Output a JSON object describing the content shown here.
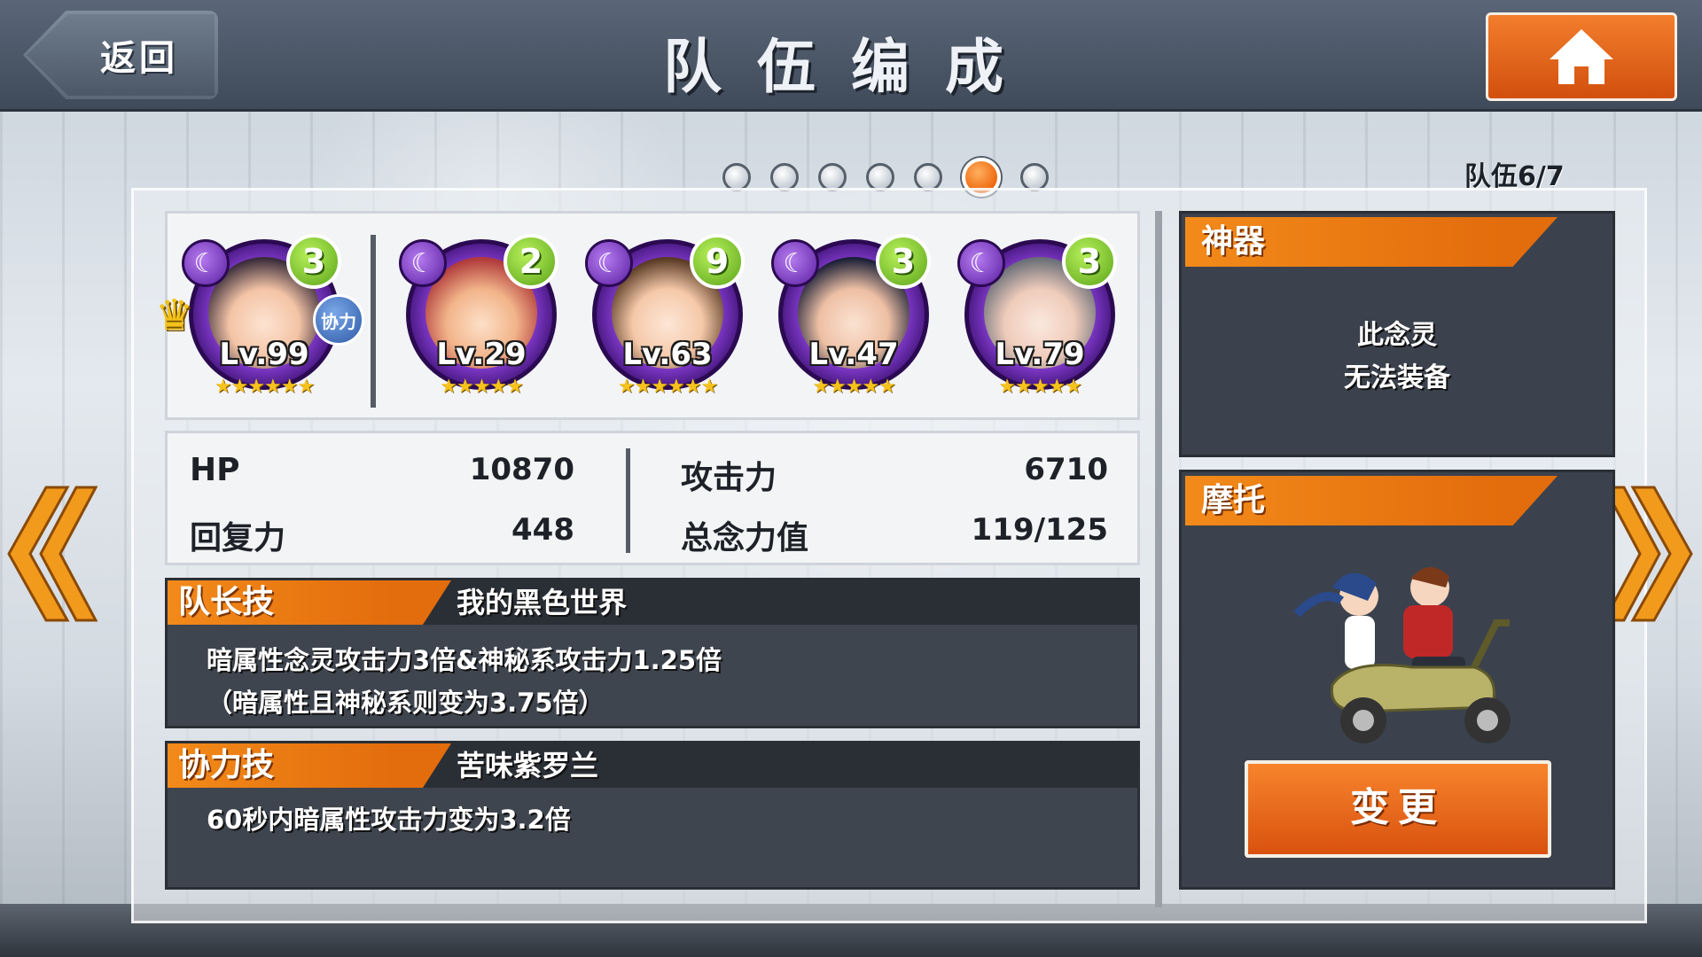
{
  "header": {
    "back_label": "返回",
    "title": "队伍编成",
    "home_icon": "home-icon"
  },
  "pager": {
    "total": 7,
    "active_index": 5,
    "team_counter": "队伍6/7"
  },
  "members": [
    {
      "level": "Lv.99",
      "cost": "3",
      "stars": "★★★★★★",
      "leader": true,
      "assist_tag": "协力",
      "element_icon": "moon-icon"
    },
    {
      "level": "Lv.29",
      "cost": "2",
      "stars": "★★★★★",
      "leader": false,
      "element_icon": "moon-icon"
    },
    {
      "level": "Lv.63",
      "cost": "9",
      "stars": "★★★★★★",
      "leader": false,
      "element_icon": "moon-icon"
    },
    {
      "level": "Lv.47",
      "cost": "3",
      "stars": "★★★★★",
      "leader": false,
      "element_icon": "moon-icon"
    },
    {
      "level": "Lv.79",
      "cost": "3",
      "stars": "★★★★★",
      "leader": false,
      "element_icon": "moon-icon"
    }
  ],
  "stats": {
    "hp_label": "HP",
    "hp_value": "10870",
    "atk_label": "攻击力",
    "atk_value": "6710",
    "rec_label": "回复力",
    "rec_value": "448",
    "cost_label": "总念力值",
    "cost_value": "119/125"
  },
  "leader_skill": {
    "tag": "队长技",
    "name": "我的黑色世界",
    "line1": "暗属性念灵攻击力3倍&神秘系攻击力1.25倍",
    "line2": "（暗属性且神秘系则变为3.75倍）"
  },
  "assist_skill": {
    "tag": "协力技",
    "name": "苦味紫罗兰",
    "line1": "60秒内暗属性攻击力变为3.2倍"
  },
  "artifact": {
    "tag": "神器",
    "note_line1": "此念灵",
    "note_line2": "无法装备"
  },
  "motor": {
    "tag": "摩托",
    "change_label": "变更"
  },
  "colors": {
    "accent_orange": "#ee6a10",
    "dark_element": "#7a36c2",
    "cost_badge": "#5ca51a"
  }
}
